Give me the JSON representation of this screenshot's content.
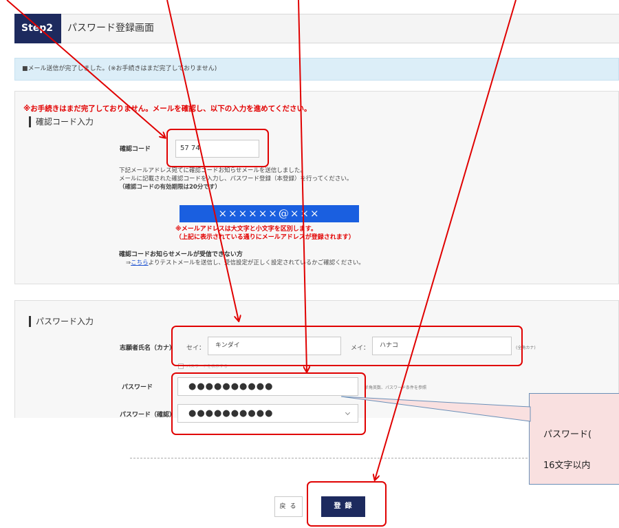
{
  "step": {
    "badge": "Step2",
    "title": "パスワード登録画面"
  },
  "notice": "■メール送信が完了しました。(※お手続きはまだ完了しておりません)",
  "confirm_section": {
    "warning": "※お手続きはまだ完了しておりません。メールを確認し、以下の入力を進めてください。",
    "heading": "確認コード入力",
    "code_label": "確認コード",
    "code_value": "57  74",
    "info_line1": "下記メールアドレス宛てに確認コードお知らせメールを送信しました。",
    "info_line2": "メールに記載された確認コードを入力し、パスワード登録（本登録）を行ってください。",
    "info_line3": "（確認コードの有効期限は20分です）",
    "email_display": "××××××@×××",
    "case_note_line1": "※メールアドレスは大文字と小文字を区別します。",
    "case_note_line2": "（上記に表示されている通りにメールアドレスが登録されます）",
    "no_mail_title": "確認コードお知らせメールが受信できない方",
    "no_mail_prefix": "⇒",
    "no_mail_link": "こちら",
    "no_mail_suffix": "よりテストメールを送信し、受信設定が正しく設定されているかご確認ください。"
  },
  "password_section": {
    "heading": "パスワード入力",
    "kana_label": "志願者氏名（カナ）",
    "sei_label": "セイ：",
    "sei_value": "キンダイ",
    "mei_label": "メイ：",
    "mei_value": "ハナコ",
    "kana_hint": "(全角カナ)",
    "checkbox_label": "パスワードを表示する",
    "pw_label": "パスワード",
    "pw_value": "●●●●●●●●●●",
    "pw_hint": "半角英数、パスワード条件を参照",
    "pw_confirm_label": "パスワード（確認）",
    "pw_confirm_value": "●●●●●●●●●●"
  },
  "buttons": {
    "back": "戻る",
    "submit": "登録"
  },
  "callout": {
    "line1": "パスワード(",
    "line2": "16文字以内"
  },
  "colors": {
    "header_navy": "#1d2a5e",
    "annotation_red": "#e00000",
    "email_blue": "#1a5fe0",
    "notice_bg": "#dceef8",
    "callout_bg": "#f9e0e0"
  }
}
